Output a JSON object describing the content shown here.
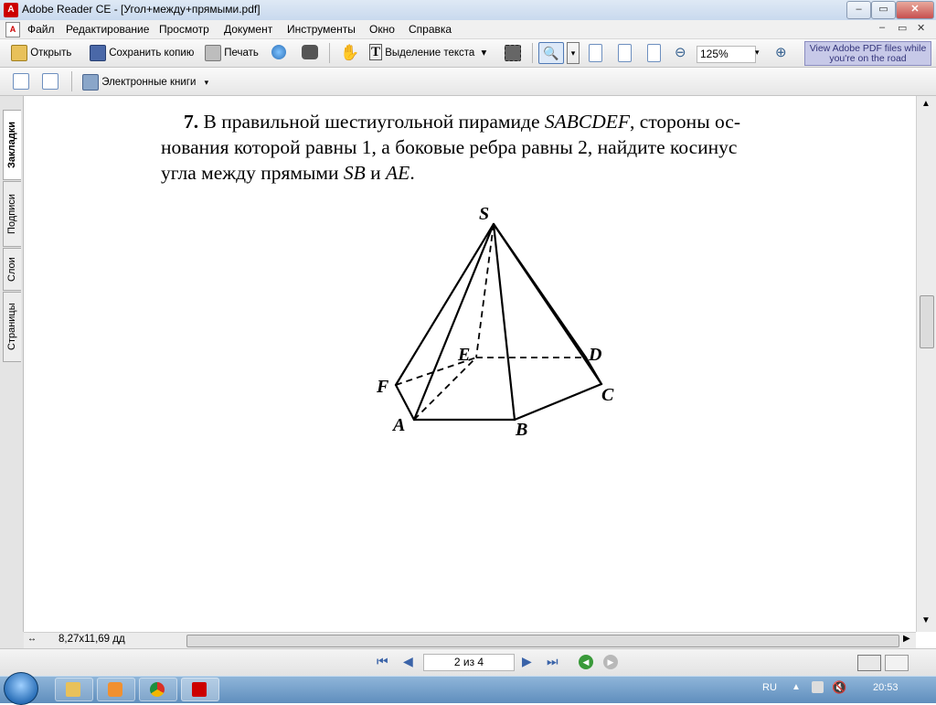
{
  "window": {
    "title": "Adobe Reader CE - [Угол+между+прямыми.pdf]",
    "app_icon": "adobe-reader-icon",
    "controls": [
      "minimize",
      "maximize",
      "close"
    ],
    "control_glyphs": [
      "–",
      "▭",
      "✕"
    ]
  },
  "menu": {
    "items": [
      "Файл",
      "Редактирование",
      "Просмотр",
      "Документ",
      "Инструменты",
      "Окно",
      "Справка"
    ],
    "doc_controls": [
      "–",
      "▭",
      "✕"
    ]
  },
  "toolbar1": {
    "open_label": "Открыть",
    "save_copy_label": "Сохранить копию",
    "print_label": "Печать",
    "select_text_label": "Выделение текста",
    "zoom_value": "125%",
    "dropdown_glyph": "▾",
    "zoom_out_glyph": "⊖",
    "zoom_in_glyph": "⊕",
    "promo_text": "View Adobe PDF files while you're on the road"
  },
  "toolbar2": {
    "ebooks_label": "Электронные книги"
  },
  "left_tabs": [
    "Закладки",
    "Подписи",
    "Слои",
    "Страницы"
  ],
  "document": {
    "problem_number": "7.",
    "line1_text": " В правильной шестиугольной пирамиде ",
    "line1_italic": "SABCDEF",
    "line1_tail": ", стороны ос-",
    "line2": "нования которой равны 1, а боковые ребра равны 2, найдите косинус",
    "line3_pre": "угла между прямыми ",
    "line3_sb": "SB",
    "line3_and": " и ",
    "line3_ae": "AE",
    "line3_end": ".",
    "figure_labels": {
      "S": "S",
      "A": "A",
      "B": "B",
      "C": "C",
      "D": "D",
      "E": "E",
      "F": "F"
    }
  },
  "status": {
    "page_size": "8,27x11,69 дд",
    "page_indicator": "2 из 4",
    "nav_glyphs": {
      "first": "⏮",
      "prev": "◀",
      "next": "▶",
      "last": "⏭",
      "back": "◀",
      "forward": "▶"
    }
  },
  "taskbar": {
    "language": "RU",
    "time": "20:53"
  },
  "colors": {
    "titlebar": "#c9d9ee",
    "menubar": "#f0f0f0",
    "taskbar": "#6f9cc8",
    "promo_bg": "#c7c9e8"
  }
}
